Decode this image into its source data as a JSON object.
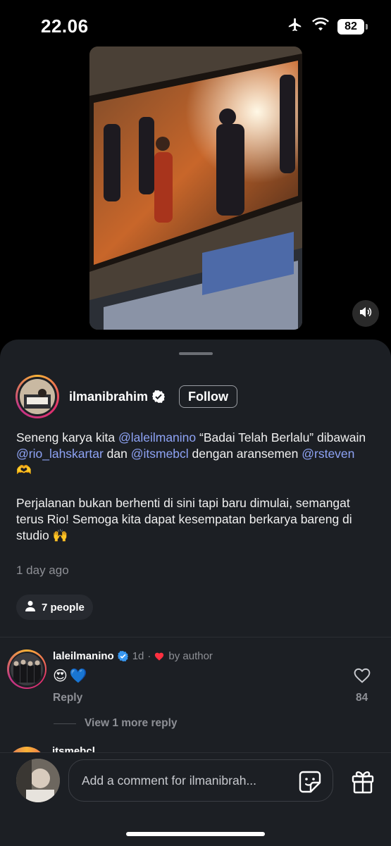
{
  "status_bar": {
    "time": "22.06",
    "battery": "82"
  },
  "post": {
    "author": "ilmanibrahim",
    "follow_label": "Follow",
    "caption_p1": [
      {
        "t": "Seneng karya kita ",
        "m": false
      },
      {
        "t": "@laleilmanino",
        "m": true
      },
      {
        "t": " “Badai Telah Berlalu” dibawain ",
        "m": false
      },
      {
        "t": "@rio_lahskartar",
        "m": true
      },
      {
        "t": " dan ",
        "m": false
      },
      {
        "t": "@itsmebcl",
        "m": true
      },
      {
        "t": " dengan aransemen ",
        "m": false
      },
      {
        "t": "@rsteven",
        "m": true
      },
      {
        "t": " 🫶",
        "m": false
      }
    ],
    "caption_p2": "Perjalanan bukan berhenti di sini tapi baru dimulai, semangat terus Rio! Semoga kita dapat kesempatan berkarya bareng di studio 🙌",
    "time_ago": "1 day ago",
    "tagged_people": "7 people"
  },
  "comments": [
    {
      "user": "laleilmanino",
      "meta_time": "1d",
      "meta_sep": "·",
      "meta_liked": "by author",
      "body": [
        "😍",
        "💙"
      ],
      "reply_label": "Reply",
      "likes": "84",
      "more_replies": "View 1 more reply"
    }
  ],
  "next_comment_peek": "itsmebcl",
  "composer": {
    "placeholder": "Add a comment for ilmanibrah..."
  },
  "colors": {
    "accent_mention": "#8ea3f5",
    "sheet_bg": "#1c1f24",
    "heart_red": "#ff3040",
    "verified_blue": "#3897f0"
  }
}
